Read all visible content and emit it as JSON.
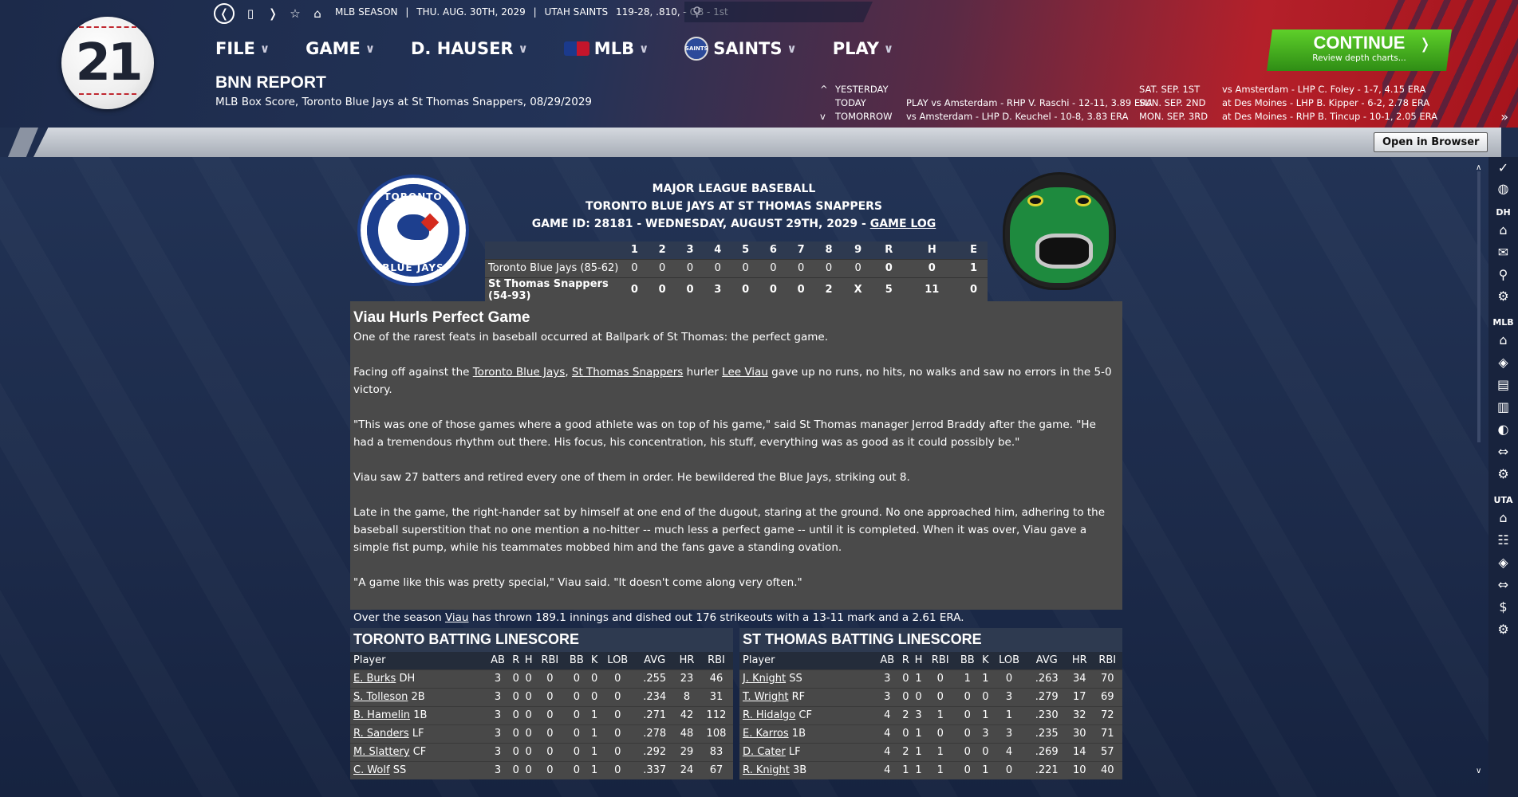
{
  "header": {
    "logo_text": "21",
    "status": [
      "MLB SEASON",
      "|",
      "THU. AUG. 30TH, 2029",
      "|",
      "UTAH SAINTS",
      "119-28, .810, - GB - 1st"
    ],
    "menu": [
      {
        "label": "FILE"
      },
      {
        "label": "GAME"
      },
      {
        "label": "D. HAUSER"
      },
      {
        "label": "MLB"
      },
      {
        "label": "SAINTS"
      },
      {
        "label": "PLAY"
      }
    ],
    "saints_logo_text": "SAINTS",
    "page_title": "BNN REPORT",
    "page_subtitle": "MLB Box Score, Toronto Blue Jays at St Thomas Snappers, 08/29/2029",
    "continue_label": "CONTINUE",
    "continue_sub": "Review depth charts...",
    "schedule": [
      {
        "arrow": "^",
        "day": "YESTERDAY",
        "today_game": "",
        "date": "SAT. SEP. 1ST",
        "game": "vs Amsterdam - LHP C. Foley - 1-7, 4.15 ERA"
      },
      {
        "arrow": "",
        "day": "TODAY",
        "today_game": "PLAY vs Amsterdam - RHP V. Raschi - 12-11, 3.89 ERA",
        "date": "SUN. SEP. 2ND",
        "game": "at Des Moines - LHP B. Kipper - 6-2, 2.78 ERA"
      },
      {
        "arrow": "v",
        "day": "TOMORROW",
        "today_game": "vs Amsterdam - LHP D. Keuchel - 10-8, 3.83 ERA",
        "date": "MON. SEP. 3RD",
        "game": "at Des Moines - RHP B. Tincup - 10-1, 2.05 ERA"
      }
    ],
    "open_in_browser": "Open in Browser"
  },
  "sidebar": {
    "labels": [
      "DH",
      "MLB",
      "UTA"
    ]
  },
  "game": {
    "league": "MAJOR LEAGUE BASEBALL",
    "matchup": "TORONTO BLUE JAYS AT ST THOMAS SNAPPERS",
    "game_id_line": "GAME ID: 28181 - WEDNESDAY, AUGUST 29TH, 2029 -",
    "game_log": "GAME LOG",
    "away_logo_top": "TORONTO",
    "away_logo_bottom": "BLUE JAYS",
    "linescore_headers": [
      "",
      "1",
      "2",
      "3",
      "4",
      "5",
      "6",
      "7",
      "8",
      "9",
      "R",
      "H",
      "E"
    ],
    "linescore_rows": [
      [
        "Toronto Blue Jays (85-62)",
        "0",
        "0",
        "0",
        "0",
        "0",
        "0",
        "0",
        "0",
        "0",
        "0",
        "0",
        "1"
      ],
      [
        "St Thomas Snappers (54-93)",
        "0",
        "0",
        "0",
        "3",
        "0",
        "0",
        "0",
        "2",
        "X",
        "5",
        "11",
        "0"
      ]
    ]
  },
  "article": {
    "headline": "Viau Hurls Perfect Game",
    "p1": "One of the rarest feats in baseball occurred at Ballpark of St Thomas: the perfect game.",
    "p2_a": "Facing off against the ",
    "p2_link1": "Toronto Blue Jays",
    "p2_b": ", ",
    "p2_link2": "St Thomas Snappers",
    "p2_c": " hurler ",
    "p2_link3": "Lee Viau",
    "p2_d": " gave up no runs, no hits, no walks and saw no errors in the 5-0 victory.",
    "p3": "\"This was one of those games where a good athlete was on top of his game,\" said St Thomas manager Jerrod Braddy after the game. \"He had a tremendous rhythm out there. His focus, his concentration, his stuff, everything was as good as it could possibly be.\"",
    "p4": "Viau saw 27 batters and retired every one of them in order. He bewildered the Blue Jays, striking out 8.",
    "p5": "Late in the game, the right-hander sat by himself at one end of the dugout, staring at the ground. No one approached him, adhering to the baseball superstition that no one mention a no-hitter -- much less a perfect game -- until it is completed. When it was over, Viau gave a simple fist pump, while his teammates mobbed him and the fans gave a standing ovation.",
    "p6": "\"A game like this was pretty special,\" Viau said. \"It doesn't come along very often.\"",
    "p7_a": "Over the season ",
    "p7_link": "Viau",
    "p7_b": " has thrown 189.1 innings and dished out 176 strikeouts with a 13-11 mark and a 2.61 ERA."
  },
  "batting": {
    "headers": [
      "Player",
      "AB",
      "R",
      "H",
      "RBI",
      "BB",
      "K",
      "LOB",
      "AVG",
      "HR",
      "RBI"
    ],
    "toronto_title": "TORONTO BATTING LINESCORE",
    "toronto": [
      {
        "name": "E. Burks",
        "pos": "DH",
        "stats": [
          "3",
          "0",
          "0",
          "0",
          "0",
          "0",
          "0",
          ".255",
          "23",
          "46"
        ]
      },
      {
        "name": "S. Tolleson",
        "pos": "2B",
        "stats": [
          "3",
          "0",
          "0",
          "0",
          "0",
          "0",
          "0",
          ".234",
          "8",
          "31"
        ]
      },
      {
        "name": "B. Hamelin",
        "pos": "1B",
        "stats": [
          "3",
          "0",
          "0",
          "0",
          "0",
          "1",
          "0",
          ".271",
          "42",
          "112"
        ]
      },
      {
        "name": "R. Sanders",
        "pos": "LF",
        "stats": [
          "3",
          "0",
          "0",
          "0",
          "0",
          "1",
          "0",
          ".278",
          "48",
          "108"
        ]
      },
      {
        "name": "M. Slattery",
        "pos": "CF",
        "stats": [
          "3",
          "0",
          "0",
          "0",
          "0",
          "1",
          "0",
          ".292",
          "29",
          "83"
        ]
      },
      {
        "name": "C. Wolf",
        "pos": "SS",
        "stats": [
          "3",
          "0",
          "0",
          "0",
          "0",
          "1",
          "0",
          ".337",
          "24",
          "67"
        ]
      }
    ],
    "stthomas_title": "ST THOMAS BATTING LINESCORE",
    "stthomas": [
      {
        "name": "J. Knight",
        "pos": "SS",
        "stats": [
          "3",
          "0",
          "1",
          "0",
          "1",
          "1",
          "0",
          ".263",
          "34",
          "70"
        ]
      },
      {
        "name": "T. Wright",
        "pos": "RF",
        "stats": [
          "3",
          "0",
          "0",
          "0",
          "0",
          "0",
          "3",
          ".279",
          "17",
          "69"
        ]
      },
      {
        "name": "R. Hidalgo",
        "pos": "CF",
        "stats": [
          "4",
          "2",
          "3",
          "1",
          "0",
          "1",
          "1",
          ".230",
          "32",
          "72"
        ]
      },
      {
        "name": "E. Karros",
        "pos": "1B",
        "stats": [
          "4",
          "0",
          "1",
          "0",
          "0",
          "3",
          "3",
          ".235",
          "30",
          "71"
        ]
      },
      {
        "name": "D. Cater",
        "pos": "LF",
        "stats": [
          "4",
          "2",
          "1",
          "1",
          "0",
          "0",
          "4",
          ".269",
          "14",
          "57"
        ]
      },
      {
        "name": "R. Knight",
        "pos": "3B",
        "stats": [
          "4",
          "1",
          "1",
          "1",
          "0",
          "1",
          "0",
          ".221",
          "10",
          "40"
        ]
      }
    ]
  }
}
